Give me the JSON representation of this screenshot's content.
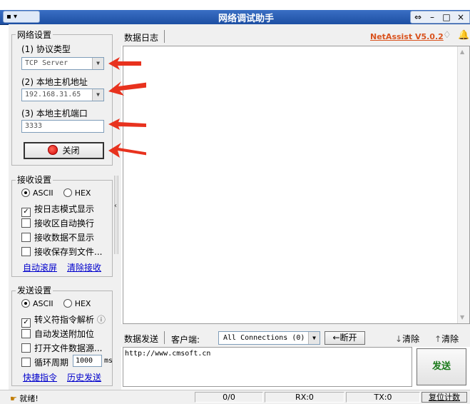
{
  "window": {
    "title": "网络调试助手",
    "sys_menu": "▾"
  },
  "network_settings": {
    "title": "网络设置",
    "protocol_label": "(1) 协议类型",
    "protocol_value": "TCP Server",
    "host_label": "(2) 本地主机地址",
    "host_value": "192.168.31.65",
    "port_label": "(3) 本地主机端口",
    "port_value": "3333",
    "close_button": "关闭"
  },
  "receive_settings": {
    "title": "接收设置",
    "ascii": "ASCII",
    "hex": "HEX",
    "format_selected": "ASCII",
    "options": [
      {
        "label": "按日志模式显示",
        "checked": true
      },
      {
        "label": "接收区自动换行",
        "checked": false
      },
      {
        "label": "接收数据不显示",
        "checked": false
      },
      {
        "label": "接收保存到文件...",
        "checked": false
      }
    ],
    "auto_scroll": "自动滚屏",
    "clear_receive": "清除接收"
  },
  "send_settings": {
    "title": "发送设置",
    "ascii": "ASCII",
    "hex": "HEX",
    "format_selected": "ASCII",
    "escape_label": "转义符指令解析",
    "escape_checked": true,
    "info_icon": "ⓘ",
    "auto_append": "自动发送附加位",
    "open_file": "打开文件数据源...",
    "loop_label": "循环周期",
    "loop_value": "1000",
    "loop_unit": "ms",
    "shortcuts": "快捷指令",
    "history": "历史发送"
  },
  "log": {
    "tab": "数据日志",
    "version": "NetAssist V5.0.2"
  },
  "send_bar": {
    "tab": "数据发送",
    "client_label": "客户端:",
    "client_value": "All Connections (0)",
    "disconnect": "断开",
    "clear1": "清除",
    "clear2": "清除",
    "send_text": "http://www.cmsoft.cn",
    "send_button": "发送"
  },
  "status": {
    "ready": "就绪!",
    "counter": "0/0",
    "rx": "RX:0",
    "tx": "TX:0",
    "reset": "复位计数"
  },
  "colors": {
    "title_bar": "#1d4fa3",
    "arrow": "#e8321e",
    "link": "#0000cc",
    "version": "#d9531e",
    "send_button": "#1a7a1a"
  }
}
